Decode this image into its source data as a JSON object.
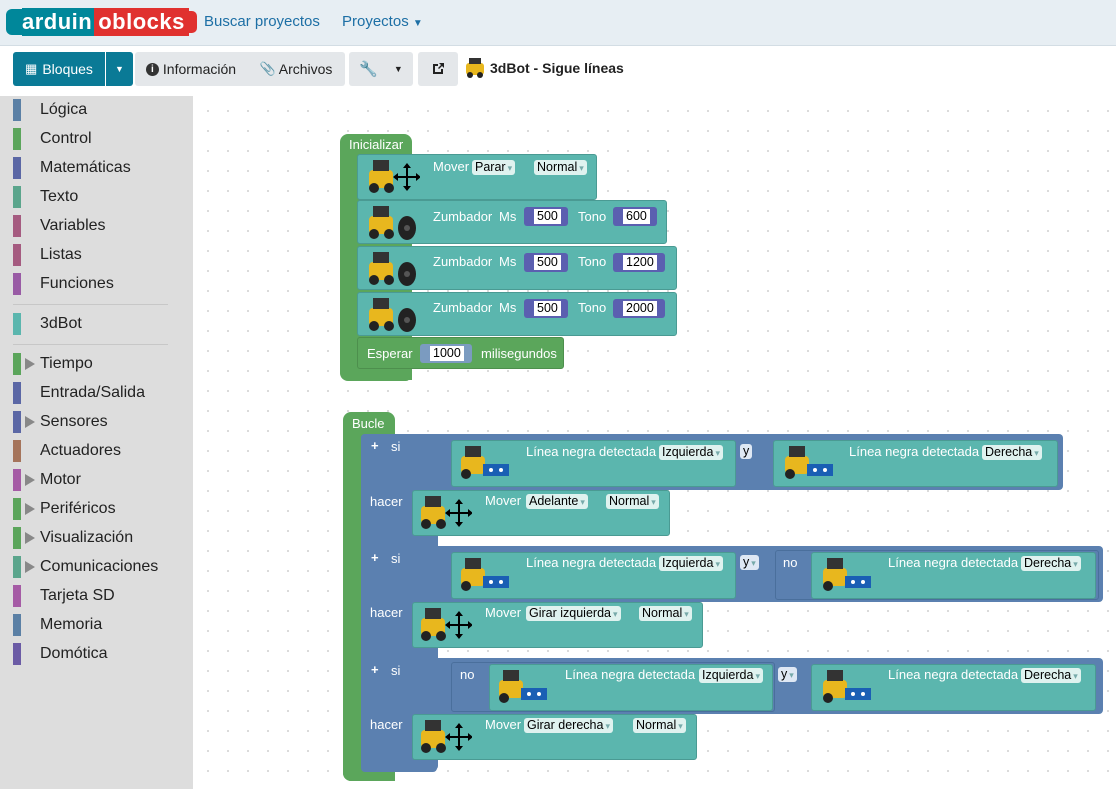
{
  "navbar": {
    "logo_a": "arduin",
    "logo_b": "oblocks",
    "links": [
      "Buscar proyectos",
      "Proyectos"
    ]
  },
  "toolbar": {
    "bloques": "Bloques",
    "informacion": "Información",
    "archivos": "Archivos",
    "project_title": "3dBot - Sigue líneas"
  },
  "sidebar": {
    "categories": [
      {
        "label": "Lógica",
        "color": "#5b80a5"
      },
      {
        "label": "Control",
        "color": "#5ba55b"
      },
      {
        "label": "Matemáticas",
        "color": "#5b67a5"
      },
      {
        "label": "Texto",
        "color": "#5ba58c"
      },
      {
        "label": "Variables",
        "color": "#a55b80"
      },
      {
        "label": "Listas",
        "color": "#a55b80"
      },
      {
        "label": "Funciones",
        "color": "#995ba5"
      },
      {
        "label": "3dBot",
        "color": "#5bb6ae"
      },
      {
        "label": "Tiempo",
        "color": "#5ba55b"
      },
      {
        "label": "Entrada/Salida",
        "color": "#5b67a5"
      },
      {
        "label": "Sensores",
        "color": "#5b67a5"
      },
      {
        "label": "Actuadores",
        "color": "#a5745b"
      },
      {
        "label": "Motor",
        "color": "#a55ba5"
      },
      {
        "label": "Periféricos",
        "color": "#5ba55b"
      },
      {
        "label": "Visualización",
        "color": "#5ba55b"
      },
      {
        "label": "Comunicaciones",
        "color": "#5ba58c"
      },
      {
        "label": "Tarjeta SD",
        "color": "#a55ba5"
      },
      {
        "label": "Memoria",
        "color": "#5b80a5"
      },
      {
        "label": "Domótica",
        "color": "#6b5ba5"
      }
    ]
  },
  "init": {
    "label": "Inicializar",
    "mover": {
      "text": "Mover",
      "dir": "Parar",
      "speed": "Normal"
    },
    "buzzers": [
      {
        "text": "Zumbador",
        "ms_label": "Ms",
        "ms": "500",
        "tono_label": "Tono",
        "tono": "600"
      },
      {
        "text": "Zumbador",
        "ms_label": "Ms",
        "ms": "500",
        "tono_label": "Tono",
        "tono": "1200"
      },
      {
        "text": "Zumbador",
        "ms_label": "Ms",
        "ms": "500",
        "tono_label": "Tono",
        "tono": "2000"
      }
    ],
    "wait": {
      "text": "Esperar",
      "value": "1000",
      "unit": "milisegundos"
    }
  },
  "loop": {
    "label": "Bucle",
    "si": "si",
    "hacer": "hacer",
    "y": "y",
    "no": "no",
    "sensor_text": "Línea negra detectada",
    "izquierda": "Izquierda",
    "derecha": "Derecha",
    "mover": "Mover",
    "normal": "Normal",
    "adelante": "Adelante",
    "girar_izq": "Girar izquierda",
    "girar_der": "Girar derecha"
  }
}
